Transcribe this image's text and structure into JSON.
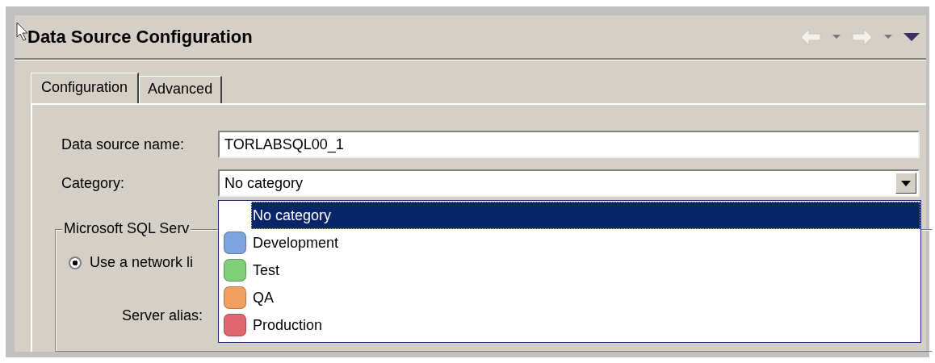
{
  "window": {
    "title": "Data Source Configuration"
  },
  "tabs": [
    {
      "label": "Configuration",
      "selected": true
    },
    {
      "label": "Advanced",
      "selected": false
    }
  ],
  "form": {
    "name_label": "Data source name:",
    "name_value": "TORLABSQL00_1",
    "category_label": "Category:",
    "category_value": "No category",
    "category_options": [
      {
        "label": "No category",
        "selected": true
      },
      {
        "label": "Development",
        "selected": false,
        "color": "#7fa3dc"
      },
      {
        "label": "Test",
        "selected": false,
        "color": "#7fcf7a"
      },
      {
        "label": "QA",
        "selected": false,
        "color": "#f0a060"
      },
      {
        "label": "Production",
        "selected": false,
        "color": "#e06870"
      }
    ]
  },
  "group": {
    "title": "Microsoft SQL Serv",
    "radio_label": "Use a network li",
    "radio_checked": true,
    "alias_label": "Server alias:"
  }
}
